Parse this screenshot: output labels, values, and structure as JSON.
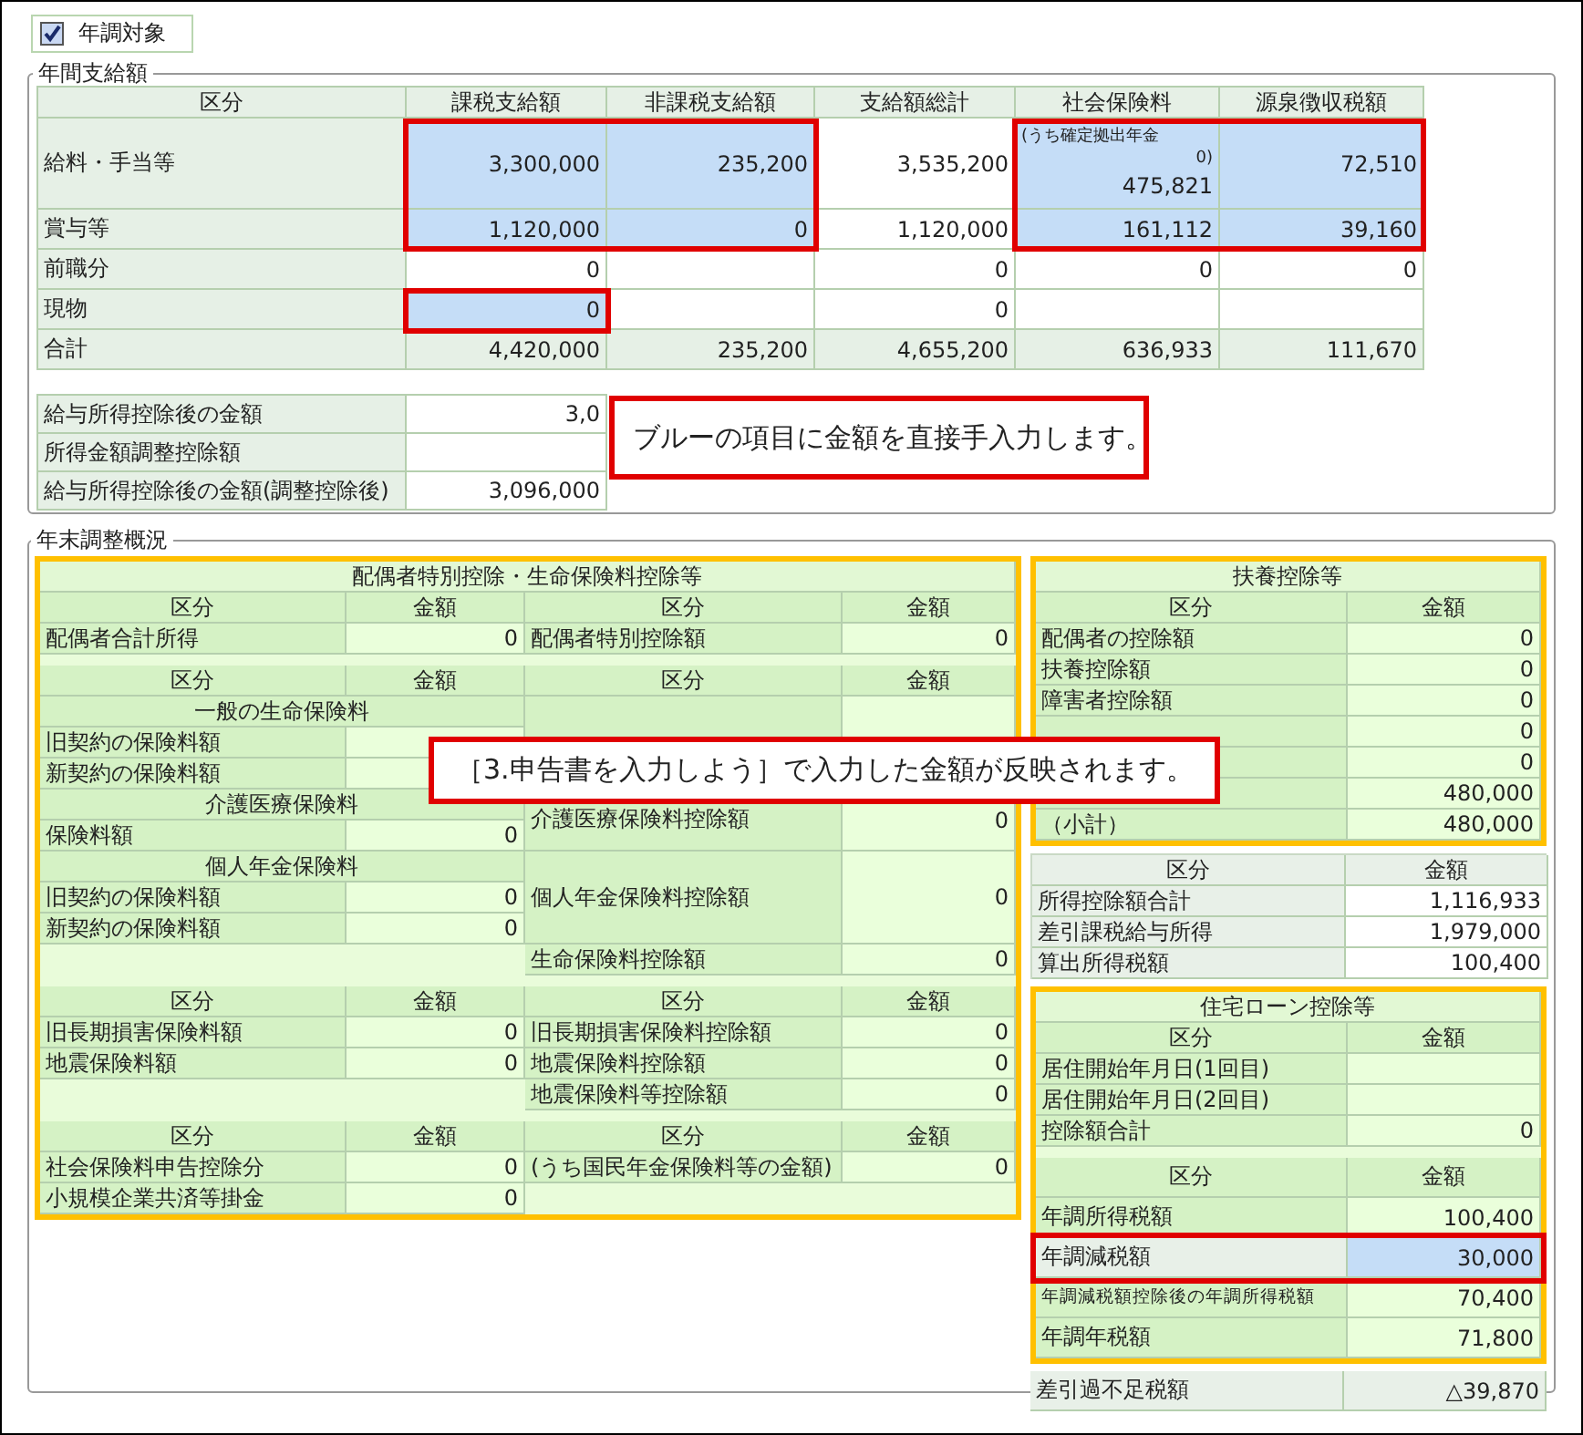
{
  "target_checkbox": {
    "label": "年調対象",
    "checked": true
  },
  "annual_pay": {
    "title": "年間支給額",
    "label_header": "区分",
    "columns": [
      "課税支給額",
      "非課税支給額",
      "支給額総計",
      "社会保険料",
      "源泉徴収税額"
    ],
    "rows": [
      {
        "label": "給料・手当等",
        "total": false,
        "cells": [
          {
            "value": "3,300,000",
            "editable": true
          },
          {
            "value": "235,200",
            "editable": true
          },
          {
            "value": "3,535,200",
            "editable": false
          },
          {
            "value": "475,821",
            "editable": true,
            "note": "(うち確定拠出年金",
            "note_value": "0)"
          },
          {
            "value": "72,510",
            "editable": true
          }
        ]
      },
      {
        "label": "賞与等",
        "total": false,
        "cells": [
          {
            "value": "1,120,000",
            "editable": true
          },
          {
            "value": "0",
            "editable": true
          },
          {
            "value": "1,120,000",
            "editable": false
          },
          {
            "value": "161,112",
            "editable": true
          },
          {
            "value": "39,160",
            "editable": true
          }
        ]
      },
      {
        "label": "前職分",
        "total": false,
        "cells": [
          {
            "value": "0",
            "editable": false
          },
          {
            "editable": false
          },
          {
            "value": "0",
            "editable": false
          },
          {
            "value": "0",
            "editable": false
          },
          {
            "value": "0",
            "editable": false
          }
        ]
      },
      {
        "label": "現物",
        "total": false,
        "cells": [
          {
            "value": "0",
            "editable": true
          },
          {
            "editable": false
          },
          {
            "value": "0",
            "editable": false
          },
          {
            "editable": false
          },
          {
            "editable": false
          }
        ]
      },
      {
        "label": "合計",
        "total": true,
        "cells": [
          {
            "value": "4,420,000",
            "editable": false
          },
          {
            "value": "235,200",
            "editable": false
          },
          {
            "value": "4,655,200",
            "editable": false
          },
          {
            "value": "636,933",
            "editable": false
          },
          {
            "value": "111,670",
            "editable": false
          }
        ]
      }
    ],
    "summary": [
      {
        "label": "給与所得控除後の金額",
        "value": "3,0"
      },
      {
        "label": "所得金額調整控除額"
      },
      {
        "label": "給与所得控除後の金額(調整控除後)",
        "value": "3,096,000"
      }
    ]
  },
  "year_end": {
    "title": "年末調整概況",
    "left_panel": {
      "title": "配偶者特別控除・生命保険料控除等",
      "blocks": [
        {
          "kind": "pairs",
          "headers": [
            "区分",
            "金額",
            "区分",
            "金額"
          ],
          "rows": [
            {
              "left": {
                "label": "配偶者合計所得",
                "value": "0"
              },
              "right": {
                "label": "配偶者特別控除額",
                "value": "0"
              }
            }
          ]
        },
        {
          "kind": "life",
          "headers": [
            "区分",
            "金額",
            "区分",
            "金額"
          ],
          "groups": [
            {
              "title": "一般の生命保険料",
              "items": [
                {
                  "label": "旧契約の保険料額"
                },
                {
                  "label": "新契約の保険料額"
                }
              ]
            },
            {
              "title": "介護医療保険料",
              "items": [
                {
                  "label": "保険料額",
                  "value": "0"
                }
              ],
              "deduction": {
                "label": "介護医療保険料控除額",
                "value": "0"
              }
            },
            {
              "title": "個人年金保険料",
              "items": [
                {
                  "label": "旧契約の保険料額",
                  "value": "0"
                },
                {
                  "label": "新契約の保険料額",
                  "value": "0"
                }
              ],
              "deduction": {
                "label": "個人年金保険料控除額",
                "value": "0"
              }
            }
          ],
          "total": {
            "label": "生命保険料控除額",
            "value": "0"
          }
        },
        {
          "kind": "pairs",
          "headers": [
            "区分",
            "金額",
            "区分",
            "金額"
          ],
          "rows": [
            {
              "left": {
                "label": "旧長期損害保険料額",
                "value": "0"
              },
              "right": {
                "label": "旧長期損害保険料控除額",
                "value": "0"
              }
            },
            {
              "left": {
                "label": "地震保険料額",
                "value": "0"
              },
              "right": {
                "label": "地震保険料控除額",
                "value": "0"
              }
            },
            {
              "right": {
                "label": "地震保険料等控除額",
                "value": "0"
              }
            }
          ]
        },
        {
          "kind": "pairs",
          "headers": [
            "区分",
            "金額",
            "区分",
            "金額"
          ],
          "rows": [
            {
              "left": {
                "label": "社会保険料申告控除分",
                "value": "0"
              },
              "right": {
                "label": "(うち国民年金保険料等の金額)",
                "value": "0"
              }
            },
            {
              "left": {
                "label": "小規模企業共済等掛金",
                "value": "0"
              }
            }
          ]
        }
      ]
    },
    "dependents": {
      "title": "扶養控除等",
      "headers": [
        "区分",
        "金額"
      ],
      "rows": [
        {
          "label": "配偶者の控除額",
          "value": "0"
        },
        {
          "label": "扶養控除額",
          "value": "0"
        },
        {
          "label": "障害者控除額",
          "value": "0"
        },
        {
          "value": "0"
        },
        {
          "value": "0"
        },
        {
          "value": "480,000"
        },
        {
          "label": "（小計）",
          "value": "480,000"
        }
      ]
    },
    "tax_summary": {
      "headers": [
        "区分",
        "金額"
      ],
      "rows": [
        {
          "label": "所得控除額合計",
          "value": "1,116,933"
        },
        {
          "label": "差引課税給与所得",
          "value": "1,979,000"
        },
        {
          "label": "算出所得税額",
          "value": "100,400"
        }
      ]
    },
    "housing_loan": {
      "title": "住宅ローン控除等",
      "headers": [
        "区分",
        "金額"
      ],
      "rows": [
        {
          "label": "居住開始年月日(1回目)"
        },
        {
          "label": "居住開始年月日(2回目)"
        },
        {
          "label": "控除額合計",
          "value": "0"
        }
      ],
      "result_headers": [
        "区分",
        "金額"
      ],
      "results": [
        {
          "label": "年調所得税額",
          "value": "100,400",
          "editable": false
        },
        {
          "label": "年調減税額",
          "value": "30,000",
          "editable": true
        },
        {
          "label": "年調減税額控除後の年調所得税額",
          "value": "70,400",
          "editable": false
        },
        {
          "label": "年調年税額",
          "value": "71,800",
          "editable": false
        }
      ]
    },
    "balance": {
      "label": "差引過不足税額",
      "value": "△39,870"
    }
  },
  "callouts": [
    {
      "text": "ブルーの項目に金額を直接手入力します。"
    },
    {
      "text": "［3.申告書を入力しよう］で入力した金額が反映されます。"
    }
  ]
}
